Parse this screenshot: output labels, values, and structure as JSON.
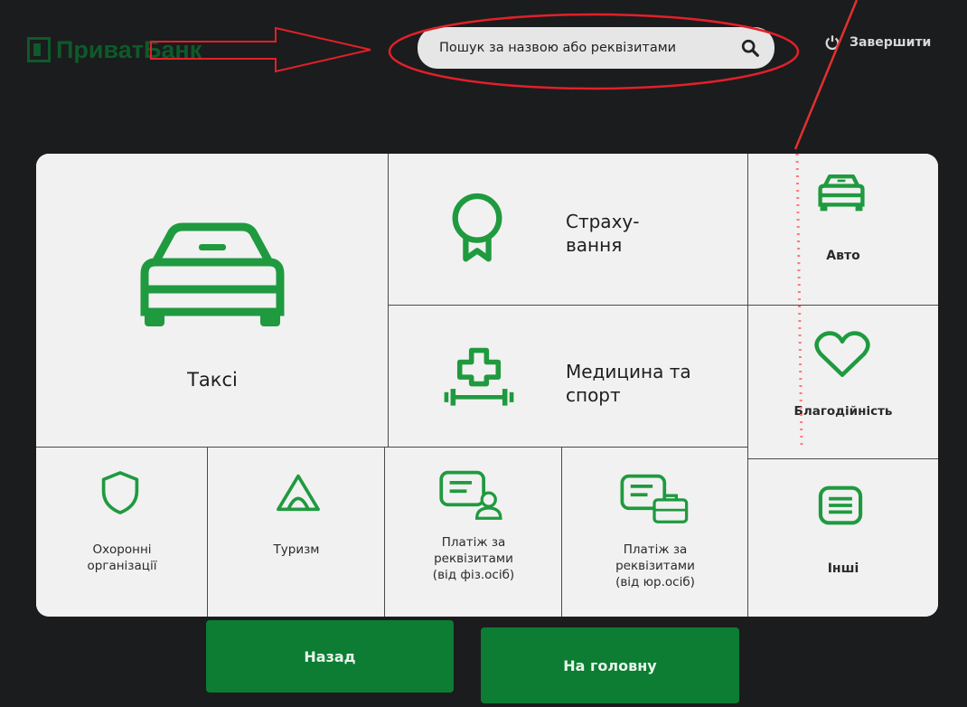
{
  "header": {
    "logo_text": "ПриватБанк",
    "search": {
      "placeholder": "Пошук за назвою або реквізитами"
    },
    "exit_label": "Завершити"
  },
  "tiles": [
    {
      "label": "Таксі",
      "icon": "car-icon"
    },
    {
      "label_line1": "Страху-",
      "label_line2": "вання",
      "icon": "award-ribbon-icon"
    },
    {
      "label": "Авто",
      "icon": "car-icon"
    },
    {
      "label_line1": "Медицина та",
      "label_line2": "спорт",
      "icon": "medical-cross-dumbbell-icon"
    },
    {
      "label": "Благодійність",
      "icon": "heart-icon"
    },
    {
      "label_line1": "Охоронні",
      "label_line2": "організації",
      "icon": "shield-icon"
    },
    {
      "label": "Туризм",
      "icon": "tent-icon"
    },
    {
      "label_line1": "Платіж за",
      "label_line2": "реквізитами",
      "label_line3": "(від фіз.осіб)",
      "icon": "document-person-icon"
    },
    {
      "label_line1": "Платіж за",
      "label_line2": "реквізитами",
      "label_line3": "(від юр.осіб)",
      "icon": "document-briefcase-icon"
    },
    {
      "label": "Інші",
      "icon": "list-icon"
    }
  ],
  "footer": {
    "back_label": "Назад",
    "home_label": "На головну"
  },
  "colors": {
    "accent": "#0c7d33",
    "icon_green": "#1f9a3f",
    "tile_bg": "#f1f1f1",
    "background": "#1b1c1d",
    "annotation_red": "#e2202a"
  }
}
